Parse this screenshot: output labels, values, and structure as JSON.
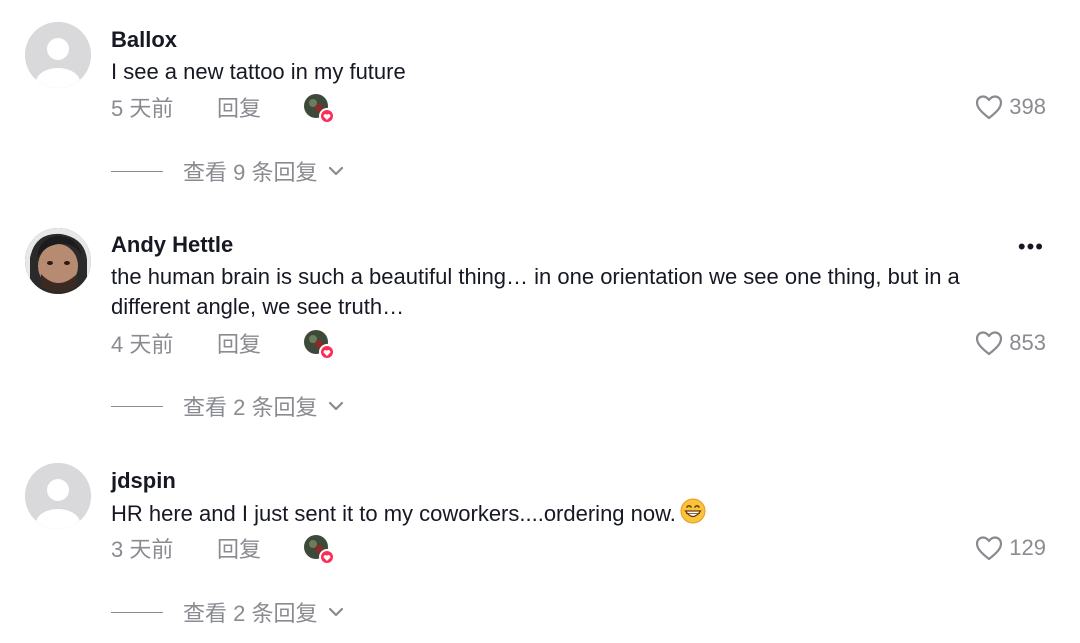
{
  "comments": [
    {
      "username": "Ballox",
      "text": "I see a new tattoo in my future",
      "time": "5 天前",
      "reply_label": "回复",
      "likes": "398",
      "view_replies": "查看 9 条回复",
      "avatar": "default-avatar-icon"
    },
    {
      "username": "Andy Hettle",
      "text": "the human brain is such a beautiful thing… in one orientation we see one thing, but in a different angle, we see truth…",
      "time": "4 天前",
      "reply_label": "回复",
      "likes": "853",
      "view_replies": "查看 2 条回复",
      "more": "•••",
      "avatar": "user-photo-avatar"
    },
    {
      "username": "jdspin",
      "text": "HR here and I just sent it to my coworkers....ordering now.",
      "time": "3 天前",
      "reply_label": "回复",
      "likes": "129",
      "view_replies": "查看 2 条回复",
      "avatar": "default-avatar-icon",
      "emoji": "grinning-face-icon"
    }
  ],
  "colors": {
    "text": "#161823",
    "secondary": "#8a8b91",
    "heart_badge": "#fe2c55"
  }
}
